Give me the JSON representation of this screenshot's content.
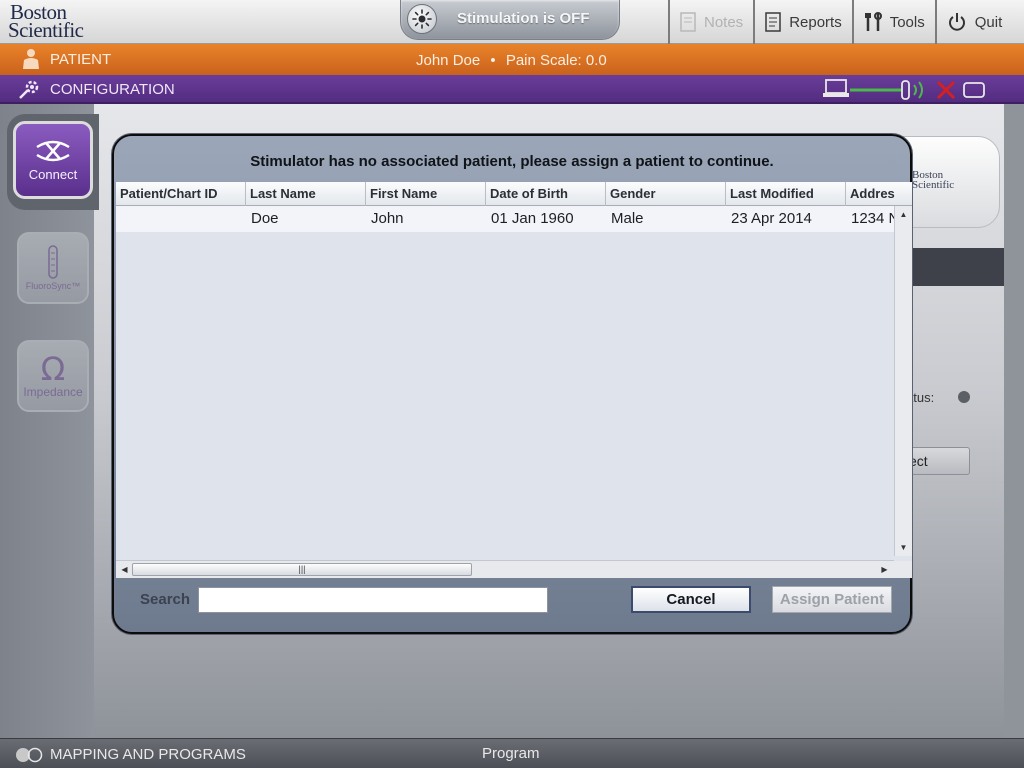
{
  "header": {
    "logo_line1": "Boston",
    "logo_line2": "Scientific",
    "stimulation_status": "Stimulation is OFF",
    "menu": [
      {
        "label": "Notes",
        "enabled": false
      },
      {
        "label": "Reports",
        "enabled": true
      },
      {
        "label": "Tools",
        "enabled": true
      },
      {
        "label": "Quit",
        "enabled": true
      }
    ]
  },
  "patient_bar": {
    "title": "PATIENT",
    "patient_name": "John Doe",
    "separator": "•",
    "pain_scale": "Pain Scale: 0.0"
  },
  "config_bar": {
    "title": "CONFIGURATION"
  },
  "sidebar": {
    "items": [
      {
        "label": "Connect",
        "active": true
      },
      {
        "label": "FluoroSync™",
        "active": false
      },
      {
        "label": "Impedance",
        "active": false
      }
    ]
  },
  "background": {
    "device_logo_line1": "Boston",
    "device_logo_line2": "Scientific",
    "status_fragment": "atus:",
    "button_fragment": "ect"
  },
  "dialog": {
    "title": "Stimulator has no associated patient, please assign a patient to continue.",
    "columns": [
      "Patient/Chart ID",
      "Last Name",
      "First Name",
      "Date of Birth",
      "Gender",
      "Last Modified",
      "Addres"
    ],
    "rows": [
      {
        "chart_id": "",
        "last_name": "Doe",
        "first_name": "John",
        "dob": "01 Jan 1960",
        "gender": "Male",
        "last_modified": "23 Apr 2014",
        "address": "1234 N"
      }
    ],
    "search_label": "Search",
    "search_value": "",
    "cancel_label": "Cancel",
    "assign_label": "Assign Patient",
    "assign_enabled": false
  },
  "bottom_bar": {
    "title": "MAPPING AND PROGRAMS",
    "center_label": "Program"
  },
  "colors": {
    "patient_bar": "#d96f22",
    "config_bar": "#5e3490",
    "connect_button": "#6e42a6",
    "x_red": "#d42020",
    "link_green": "#4cb84a"
  }
}
